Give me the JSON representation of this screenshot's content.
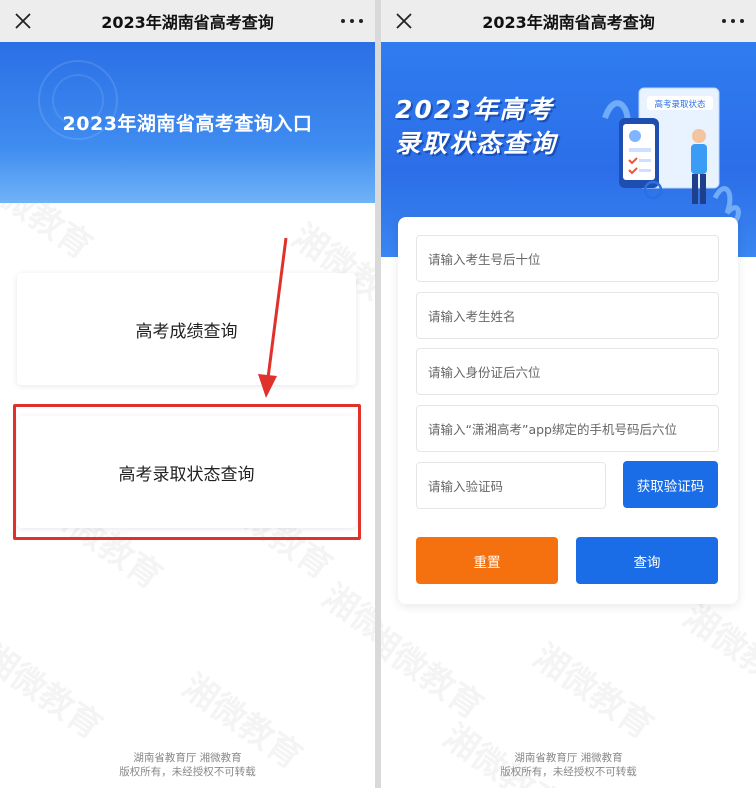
{
  "left": {
    "nav_title": "2023年湖南省高考查询",
    "banner_title": "2023年湖南省高考查询入口",
    "score_query": "高考成绩查询",
    "status_query": "高考录取状态查询",
    "footer_line1": "湖南省教育厅 湘微教育",
    "footer_line2": "版权所有，未经授权不可转载"
  },
  "right": {
    "nav_title": "2023年湖南省高考查询",
    "promo_line1": "2023年高考",
    "promo_line2": "录取状态查询",
    "illus_tag": "高考录取状态",
    "placeholder_exam_no": "请输入考生号后十位",
    "placeholder_name": "请输入考生姓名",
    "placeholder_id": "请输入身份证后六位",
    "placeholder_phone": "请输入“潇湘高考”app绑定的手机号码后六位",
    "placeholder_code": "请输入验证码",
    "get_code": "获取验证码",
    "reset": "重置",
    "query": "查询",
    "footer_line1": "湖南省教育厅 湘微教育",
    "footer_line2": "版权所有，未经授权不可转载"
  },
  "watermark_text": "湘微教育",
  "colors": {
    "brand_blue": "#1a6de6",
    "reset_orange": "#f5700e",
    "highlight_red": "#e0312b"
  }
}
